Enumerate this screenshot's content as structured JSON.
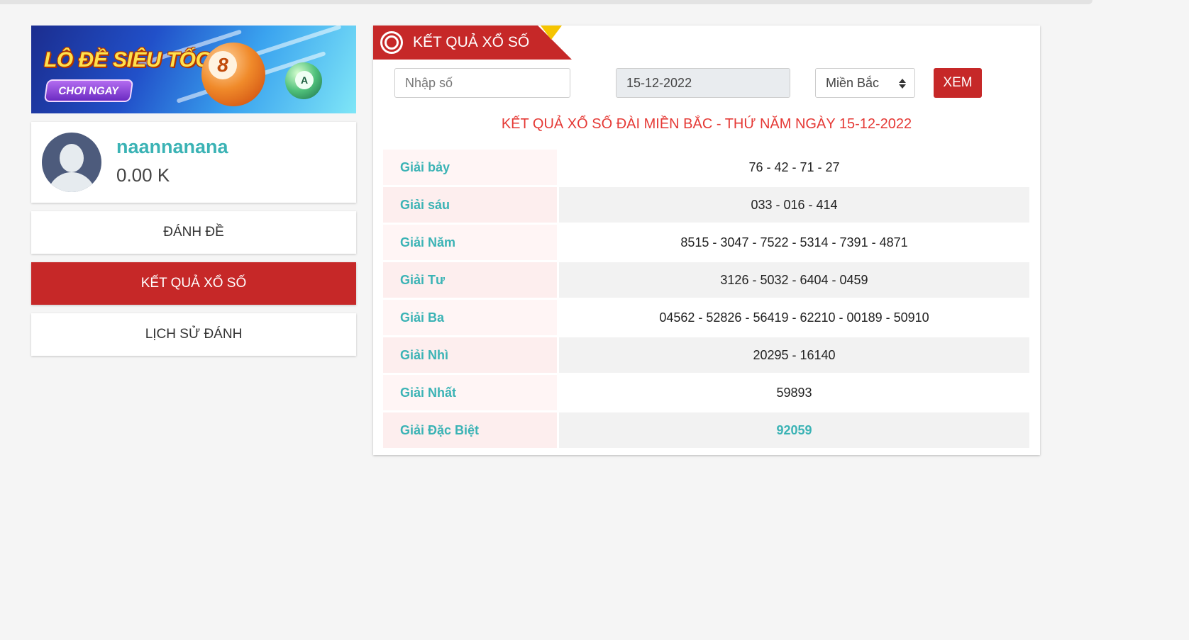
{
  "banner": {
    "title": "LÔ ĐỀ SIÊU TỐC",
    "cta": "CHƠI NGAY",
    "ball_big": "8",
    "ball_small": "A"
  },
  "user": {
    "name": "naannanana",
    "balance": "0.00 K"
  },
  "menu": {
    "items": [
      {
        "label": "ĐÁNH ĐỀ",
        "active": false
      },
      {
        "label": "KẾT QUẢ XỔ SỐ",
        "active": true
      },
      {
        "label": "LỊCH SỬ ĐÁNH",
        "active": false
      }
    ]
  },
  "panel": {
    "title": "KẾT QUẢ XỔ SỐ",
    "icon": "lottery-icon"
  },
  "search": {
    "number_placeholder": "Nhập số",
    "date_value": "15-12-2022",
    "region_selected": "Miền Bắc",
    "submit_label": "XEM"
  },
  "results": {
    "heading": "KẾT QUẢ XỔ SỐ ĐÀI MIỀN BẮC - THỨ NĂM NGÀY 15-12-2022",
    "rows": [
      {
        "prize": "Giải bảy",
        "numbers": "76 - 42 - 71 - 27"
      },
      {
        "prize": "Giải sáu",
        "numbers": "033 - 016 - 414"
      },
      {
        "prize": "Giải Năm",
        "numbers": "8515 - 3047 - 7522 - 5314 - 7391 - 4871"
      },
      {
        "prize": "Giải Tư",
        "numbers": "3126 - 5032 - 6404 - 0459"
      },
      {
        "prize": "Giải Ba",
        "numbers": "04562 - 52826 - 56419 - 62210 - 00189 - 50910"
      },
      {
        "prize": "Giải Nhì",
        "numbers": "20295 - 16140"
      },
      {
        "prize": "Giải Nhất",
        "numbers": "59893"
      },
      {
        "prize": "Giải Đặc Biệt",
        "numbers": "92059"
      }
    ]
  },
  "colors": {
    "accent_red": "#c62828",
    "teal": "#3bb3b5",
    "heading_red": "#e53935"
  }
}
